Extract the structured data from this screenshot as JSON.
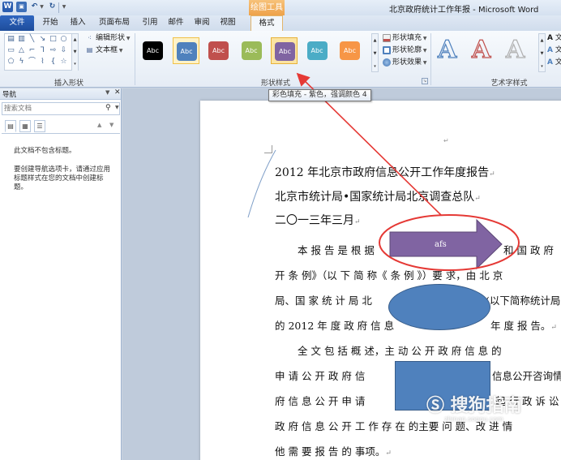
{
  "window": {
    "title": "北京政府统计工作年报 - Microsoft Word",
    "context_tab_group": "绘图工具"
  },
  "quick_access": {
    "app_icon": "W",
    "items": [
      "save-icon",
      "undo-icon",
      "redo-icon",
      "customize-icon"
    ]
  },
  "tabs": {
    "file": "文件",
    "start": "开始",
    "insert": "插入",
    "layout": "页面布局",
    "references": "引用",
    "mailings": "邮件",
    "review": "审阅",
    "view": "视图",
    "format": "格式"
  },
  "ribbon": {
    "insert_shapes": {
      "label": "插入形状",
      "edit_shape": "编辑形状",
      "text_box": "文本框"
    },
    "shape_styles": {
      "label": "形状样式",
      "swatch_text": "Abc",
      "swatches": [
        {
          "fill": "#000000",
          "name": "black"
        },
        {
          "fill": "#4f81bd",
          "name": "blue"
        },
        {
          "fill": "#c0504d",
          "name": "red"
        },
        {
          "fill": "#9bbb59",
          "name": "green"
        },
        {
          "fill": "#8064a2",
          "name": "purple"
        },
        {
          "fill": "#4bacc6",
          "name": "aqua"
        },
        {
          "fill": "#f79646",
          "name": "orange"
        }
      ],
      "fill": "形状填充",
      "outline": "形状轮廓",
      "effects": "形状效果"
    },
    "wordart": {
      "label": "艺术字样式",
      "letter": "A",
      "text_cmd": "文"
    }
  },
  "tooltip": "彩色填充 - 紫色，强调颜色 4",
  "nav": {
    "title": "导航",
    "search_placeholder": "搜索文档",
    "message1": "此文档不包含标题。",
    "message2": "要创建导航选项卡，请通过应用标题样式在您的文档中创建标题。"
  },
  "document": {
    "lines": [
      "2012 年北京市政府信息公开工作年度报告",
      "北京市统计局•国家统计局北京调查总队",
      "二〇一三年三月",
      "本 报 告 是 根 据",
      "开 条 例》（以 下 简 称《 条 例 》）要 求，由 北 京",
      "局、国 家 统 计 局 北",
      "的 2012 年 度 政 府 信 息",
      "全 文 包 括 概 述，主 动 公 开 政 府 信 息 的",
      "申 请 公 开 政 府 信",
      "府 信 息 公 开 申 请",
      "政 府 信 息 公 开 工 作 存 在 的主要 问 题、改 进 情",
      "他 需 要 报 告 的 事项。"
    ],
    "line4_right": "和 国 政 府",
    "line6_right": "(以下简称统计局",
    "line7_right": "年 度 报 告。",
    "line9_right": "信息公开咨询情",
    "line10_right": "起 行 政 诉 讼",
    "para_mark": "↵",
    "arrow_label": "afs"
  },
  "colors": {
    "accent_blue": "#4f81bd",
    "arrow_fill": "#8064a2",
    "annotation_red": "#e53935"
  }
}
